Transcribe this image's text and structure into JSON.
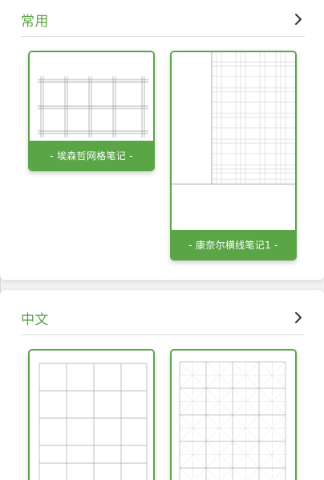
{
  "sections": {
    "common": {
      "title": "常用",
      "templates": [
        {
          "label": "- 埃森哲网格笔记 -"
        },
        {
          "label": "- 康奈尔横线笔记1 -"
        }
      ]
    },
    "chinese": {
      "title": "中文",
      "templates": [
        {
          "label": ""
        },
        {
          "label": ""
        }
      ]
    }
  },
  "colors": {
    "accent": "#5aa545",
    "divider": "#dcdcdc",
    "background": "#f2f2f2"
  },
  "icons": {
    "more": "chevron-right-icon"
  }
}
